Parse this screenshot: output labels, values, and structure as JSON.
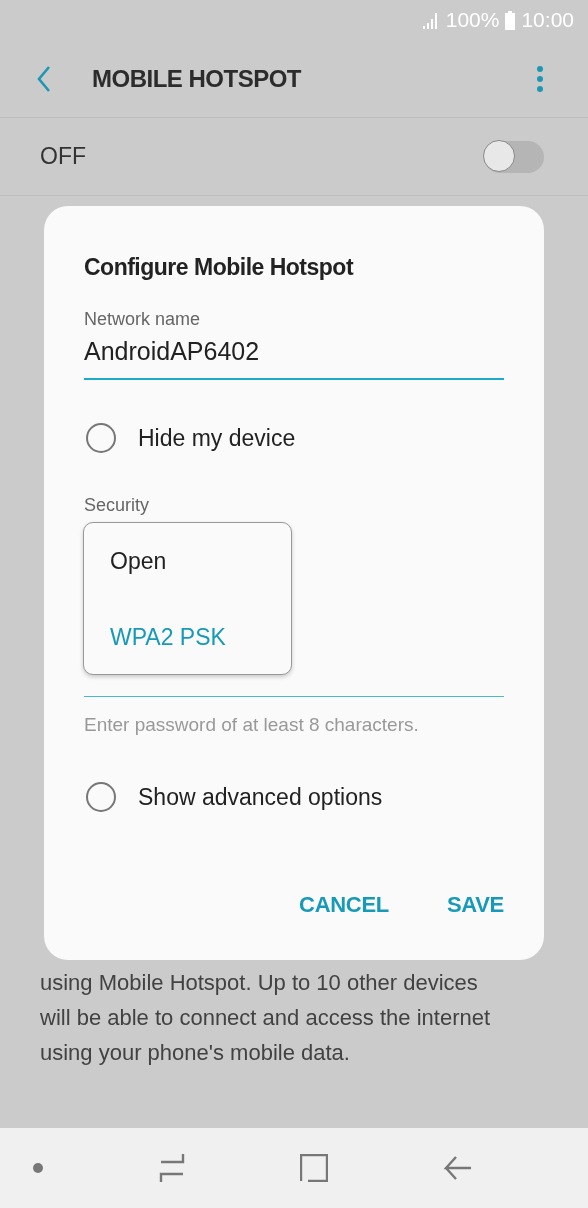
{
  "status_bar": {
    "battery": "100%",
    "time": "10:00"
  },
  "app_bar": {
    "title": "MOBILE HOTSPOT"
  },
  "master_switch": {
    "label": "OFF",
    "on": false
  },
  "description_lines": [
    "using Mobile Hotspot. Up to 10 other devices",
    "will be able to connect and access the internet",
    "using your phone's mobile data."
  ],
  "dialog": {
    "title": "Configure Mobile Hotspot",
    "network_name": {
      "label": "Network name",
      "value": "AndroidAP6402"
    },
    "hide_device": {
      "label": "Hide my device",
      "checked": false
    },
    "security": {
      "label": "Security",
      "options": [
        {
          "label": "Open",
          "selected": false
        },
        {
          "label": "WPA2 PSK",
          "selected": true
        }
      ]
    },
    "password": {
      "hint": "Enter password of at least 8 characters."
    },
    "advanced": {
      "label": "Show advanced options",
      "checked": false
    },
    "buttons": [
      {
        "label": "CANCEL"
      },
      {
        "label": "SAVE"
      }
    ]
  }
}
